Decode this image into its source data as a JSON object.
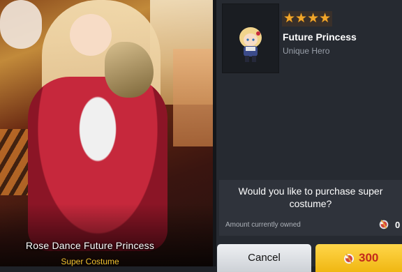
{
  "costume": {
    "name": "Rose Dance Future Princess",
    "type": "Super Costume"
  },
  "hero": {
    "rating_stars": 4,
    "name": "Future Princess",
    "rank": "Unique Hero"
  },
  "purchase": {
    "prompt": "Would you like to purchase super costume?",
    "owned_label": "Amount currently owned",
    "owned_count": "0",
    "cancel_label": "Cancel",
    "price": "300",
    "currency_icon": "gem-ball-icon"
  },
  "colors": {
    "accent_yellow": "#f2c230",
    "price_red": "#c32a1c",
    "star_orange": "#f1a62a"
  }
}
